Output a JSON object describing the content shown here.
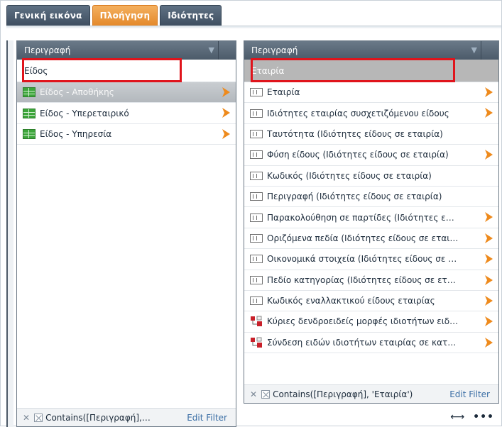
{
  "tabs": [
    {
      "label": "Γενική εικόνα",
      "active": false
    },
    {
      "label": "Πλοήγηση",
      "active": true
    },
    {
      "label": "Ιδιότητες",
      "active": false
    }
  ],
  "left_panel": {
    "header": "Περιγραφή",
    "filter_value": "Είδος",
    "items": [
      {
        "label": "Είδος - Αποθήκης",
        "selected": true,
        "has_arrow": true
      },
      {
        "label": "Είδος - Υπερεταιρικό",
        "selected": false,
        "has_arrow": true
      },
      {
        "label": "Είδος - Υπηρεσία",
        "selected": false,
        "has_arrow": true
      }
    ],
    "footer_filter": "Contains([Περιγραφή],…",
    "edit_filter": "Edit Filter"
  },
  "right_panel": {
    "header": "Περιγραφή",
    "filter_value": "Εταιρία",
    "items": [
      {
        "label": "Εταιρία",
        "icon": "property-icon",
        "has_arrow": true
      },
      {
        "label": "Ιδιότητες εταιρίας συσχετιζόμενου είδους",
        "icon": "property-icon",
        "has_arrow": true
      },
      {
        "label": "Ταυτότητα (Ιδιότητες είδους σε εταιρία)",
        "icon": "property-icon",
        "has_arrow": false
      },
      {
        "label": "Φύση είδους (Ιδιότητες είδους σε εταιρία)",
        "icon": "property-icon",
        "has_arrow": true
      },
      {
        "label": "Κωδικός (Ιδιότητες είδους σε εταιρία)",
        "icon": "property-icon",
        "has_arrow": false
      },
      {
        "label": "Περιγραφή (Ιδιότητες είδους σε εταιρία)",
        "icon": "property-icon",
        "has_arrow": false
      },
      {
        "label": "Παρακολούθηση σε παρτίδες (Ιδιότητες ε…",
        "icon": "property-icon",
        "has_arrow": true
      },
      {
        "label": "Οριζόμενα πεδία (Ιδιότητες είδους σε εται…",
        "icon": "property-icon",
        "has_arrow": true
      },
      {
        "label": "Οικονομικά στοιχεία (Ιδιότητες είδους σε …",
        "icon": "property-icon",
        "has_arrow": true
      },
      {
        "label": "Πεδίο κατηγορίας (Ιδιότητες είδους σε ετ…",
        "icon": "property-icon",
        "has_arrow": true
      },
      {
        "label": "Κωδικός εναλλακτικού είδους εταιρίας",
        "icon": "property-icon",
        "has_arrow": true
      },
      {
        "label": "Κύριες δενδροειδείς μορφές ιδιοτήτων ειδ…",
        "icon": "tree-icon",
        "has_arrow": true
      },
      {
        "label": "Σύνδεση ειδών ιδιοτήτων εταιρίας σε κατ…",
        "icon": "tree-icon",
        "has_arrow": true
      }
    ],
    "footer_filter": "Contains([Περιγραφή], 'Εταιρία')",
    "edit_filter": "Edit Filter"
  },
  "colors": {
    "accent_orange": "#ee8a1c",
    "highlight_red": "#e0141c",
    "header_gray": "#5b6a79"
  }
}
